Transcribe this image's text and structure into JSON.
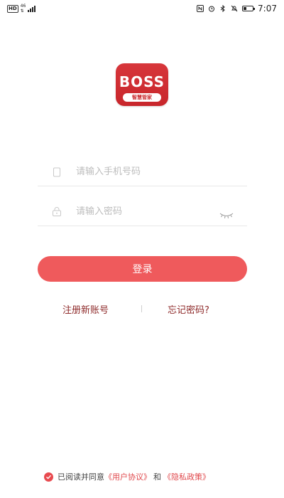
{
  "status_bar": {
    "hd": "HD",
    "network_top": "46",
    "network_bottom": "⇅",
    "time": "7:07",
    "battery_level": 0.35,
    "icons": [
      "nfc-icon",
      "alarm-icon",
      "bluetooth-icon",
      "mute-icon",
      "battery-icon"
    ]
  },
  "logo": {
    "text": "BOSS",
    "subtitle": "智慧管家",
    "brand_color": "#c8262b"
  },
  "form": {
    "phone_placeholder": "请输入手机号码",
    "password_placeholder": "请输入密码",
    "login_label": "登录",
    "accent_color": "#ef5a5c"
  },
  "links": {
    "register": "注册新账号",
    "forgot": "忘记密码?"
  },
  "agreement": {
    "prefix": "已阅读并同意",
    "user_agreement": "《用户协议》",
    "and": "和",
    "privacy_policy": "《隐私政策》",
    "checked": true
  }
}
